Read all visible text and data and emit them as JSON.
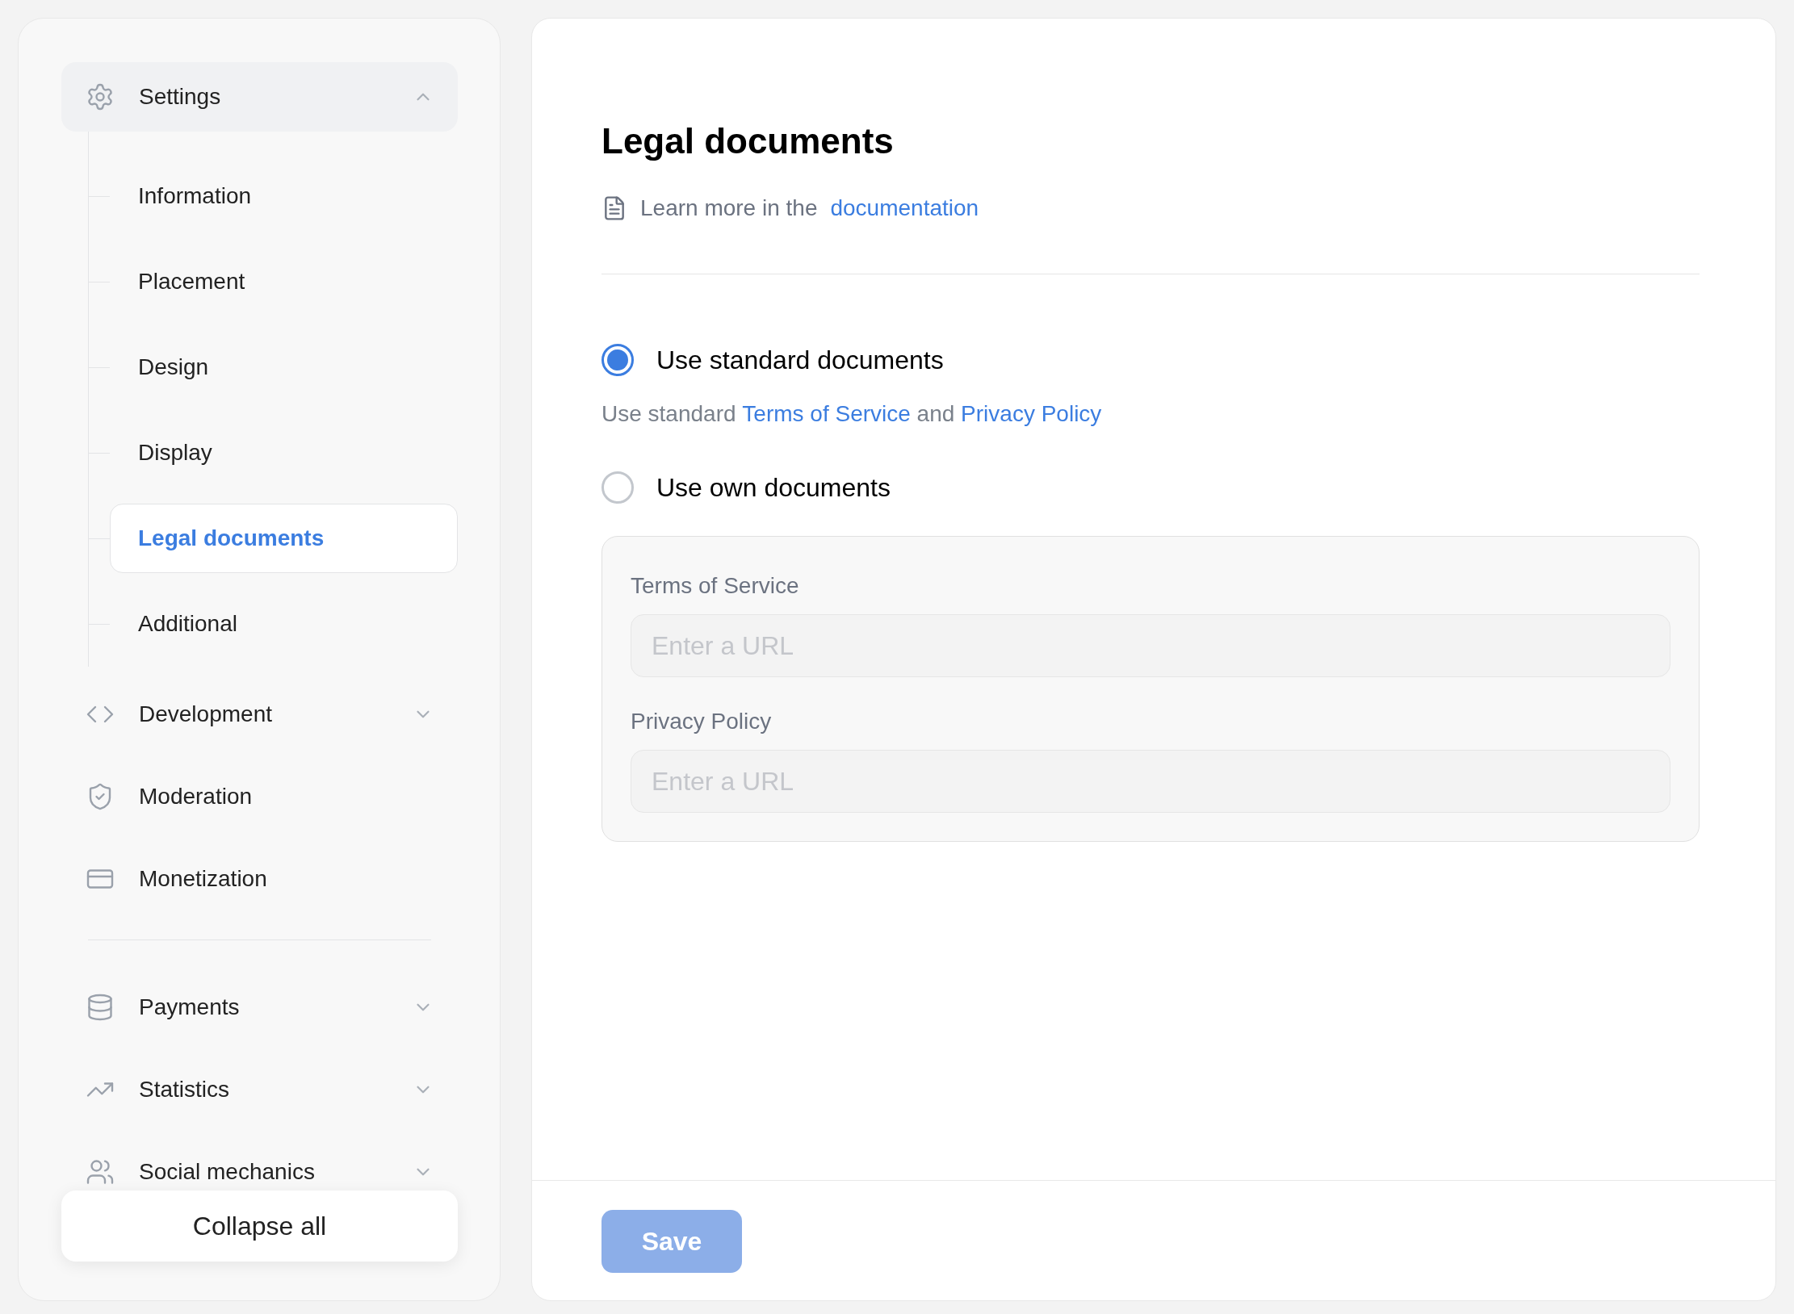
{
  "sidebar": {
    "groups": [
      {
        "label": "Settings",
        "kind": "group",
        "expanded": true,
        "children": [
          {
            "label": "Information",
            "selected": false
          },
          {
            "label": "Placement",
            "selected": false
          },
          {
            "label": "Design",
            "selected": false
          },
          {
            "label": "Display",
            "selected": false
          },
          {
            "label": "Legal documents",
            "selected": true
          },
          {
            "label": "Additional",
            "selected": false
          }
        ]
      },
      {
        "label": "Development",
        "kind": "group",
        "expanded": false
      },
      {
        "label": "Moderation",
        "kind": "link"
      },
      {
        "label": "Monetization",
        "kind": "link"
      },
      {
        "kind": "divider"
      },
      {
        "label": "Payments",
        "kind": "group",
        "expanded": false
      },
      {
        "label": "Statistics",
        "kind": "group",
        "expanded": false
      },
      {
        "label": "Social mechanics",
        "kind": "group",
        "expanded": false
      }
    ],
    "collapse_button": "Collapse all"
  },
  "main": {
    "title": "Legal documents",
    "help": {
      "text": "Learn more in the",
      "link": "documentation"
    },
    "options": [
      {
        "label": "Use standard documents",
        "selected": true,
        "description": [
          "Use standard ",
          "Terms of Service",
          " and ",
          "Privacy Policy"
        ]
      },
      {
        "label": "Use own documents",
        "selected": false
      }
    ],
    "fields": [
      {
        "label": "Terms of Service",
        "placeholder": "Enter a URL"
      },
      {
        "label": "Privacy Policy",
        "placeholder": "Enter a URL"
      }
    ],
    "save_button": {
      "label": "Save",
      "disabled": true
    }
  }
}
